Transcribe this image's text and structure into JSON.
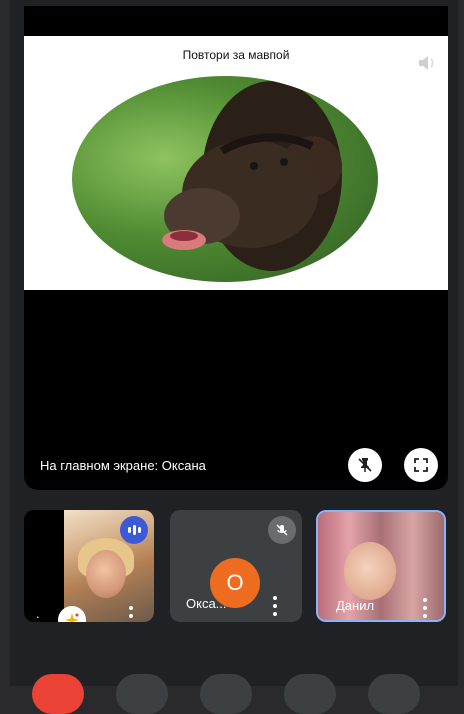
{
  "slide": {
    "title": "Повтори за мавпой"
  },
  "stage": {
    "label": "На главном экране: Оксана"
  },
  "tiles": [
    {
      "name": "",
      "first_char": "."
    },
    {
      "name": "Окса...",
      "avatar_letter": "О"
    },
    {
      "name": "Данил"
    }
  ],
  "colors": {
    "end_call": "#ea4335",
    "avatar": "#ee6c1f",
    "speaking": "#3c5ad6",
    "active_border": "#8ab4f8"
  }
}
